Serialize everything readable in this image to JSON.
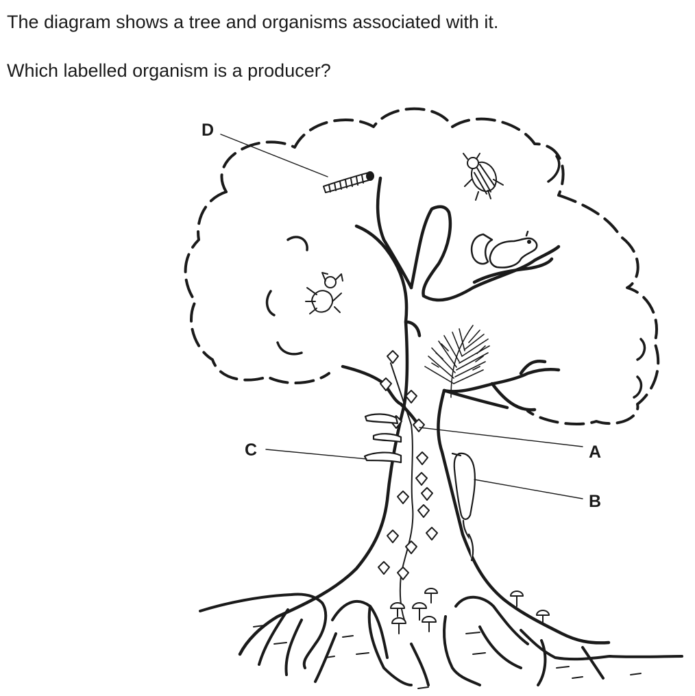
{
  "question": {
    "line1": "The diagram shows a tree and organisms associated with it.",
    "line2": "Which labelled organism is a producer?"
  },
  "diagram": {
    "labels": {
      "a": "A",
      "b": "B",
      "c": "C",
      "d": "D"
    },
    "icons": [
      "tree",
      "caterpillar",
      "beetle",
      "squirrel",
      "spider",
      "fern",
      "ivy",
      "bracket-fungus",
      "woodpecker",
      "mushroom"
    ]
  }
}
